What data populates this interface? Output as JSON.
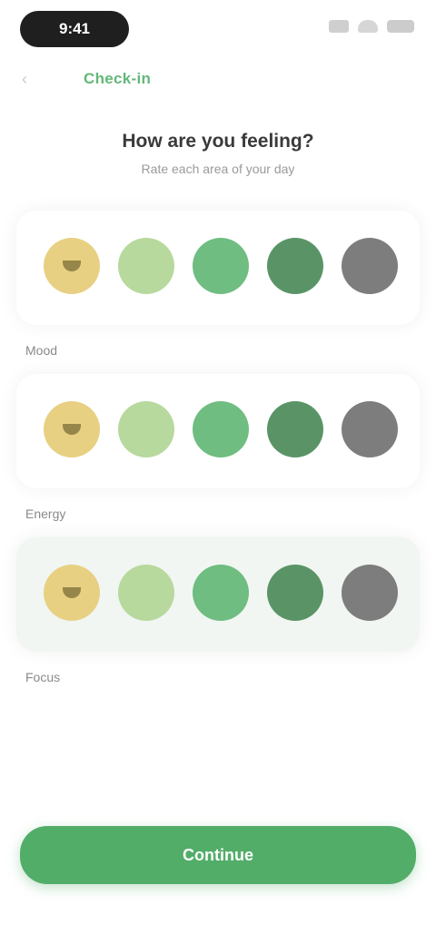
{
  "status_bar": {
    "time": "9:41"
  },
  "nav": {
    "back_icon": "chevron-left-icon",
    "breadcrumb": "Check-in"
  },
  "header": {
    "title": "How are you feeling?",
    "subtitle": "Rate each area of your day"
  },
  "ratings": [
    {
      "label": "Mood",
      "selected": false
    },
    {
      "label": "Energy",
      "selected": false
    },
    {
      "label": "Focus",
      "selected": true
    }
  ],
  "scale_colors": [
    "#e8d083",
    "#b7d99d",
    "#6fbd80",
    "#5a9466",
    "#7d7d7d"
  ],
  "primary_button": {
    "label": "Continue"
  },
  "colors": {
    "accent": "#52ad69",
    "breadcrumb": "#63b87a"
  }
}
